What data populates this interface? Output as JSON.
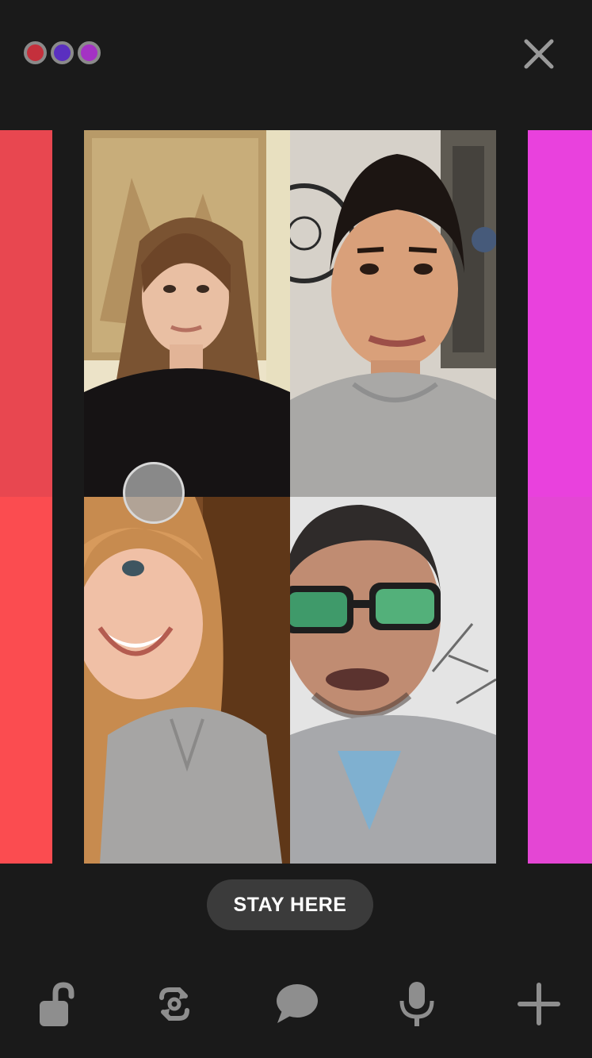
{
  "header": {
    "room_dots": [
      {
        "name": "red",
        "color": "#c4303c"
      },
      {
        "name": "blue",
        "color": "#5a2fc0"
      },
      {
        "name": "purple",
        "color": "#a432c4"
      }
    ],
    "close_icon": "close-icon"
  },
  "side_panels": {
    "left_color_top": "#e84750",
    "left_color_bottom": "#fb4c50",
    "right_color_top": "#e941dd",
    "right_color_bottom": "#e446d4"
  },
  "participants": [
    {
      "label": "participant-1",
      "bg": "#e8dcc0"
    },
    {
      "label": "participant-2",
      "bg": "#cfcdc8"
    },
    {
      "label": "participant-3",
      "bg": "#8b5a2b"
    },
    {
      "label": "participant-4",
      "bg": "#e6e6e6"
    }
  ],
  "actions": {
    "stay_label": "STAY HERE"
  },
  "toolbar": {
    "icons": [
      "lock-open-icon",
      "flip-camera-icon",
      "chat-icon",
      "microphone-icon",
      "add-icon"
    ],
    "icon_color": "#8e8e8e"
  }
}
